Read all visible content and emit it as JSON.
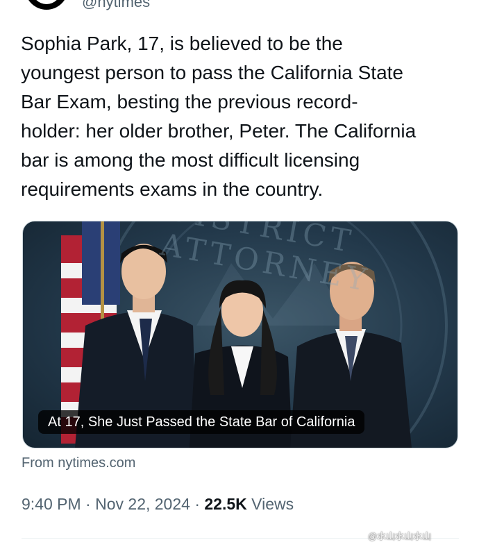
{
  "author": {
    "handle": "@nytimes"
  },
  "tweet": {
    "text": "Sophia Park, 17, is believed to be the\nyoungest person to pass the California State\nBar Exam, besting the previous record-\nholder: her older brother, Peter. The California\nbar is among the most difficult licensing\nrequirements exams in the country."
  },
  "media": {
    "seal_text": "DISTRICT ATTORNEY",
    "caption": "At 17, She Just Passed the State Bar of California"
  },
  "link_source": "From nytimes.com",
  "meta": {
    "time": "9:40 PM",
    "separator": "·",
    "date": "Nov 22, 2024",
    "views_count": "22.5K",
    "views_label": "Views"
  },
  "watermark": "@水山水山水山",
  "colors": {
    "text_primary": "#0f1419",
    "text_secondary": "#536471",
    "media_background": "#22384a"
  }
}
